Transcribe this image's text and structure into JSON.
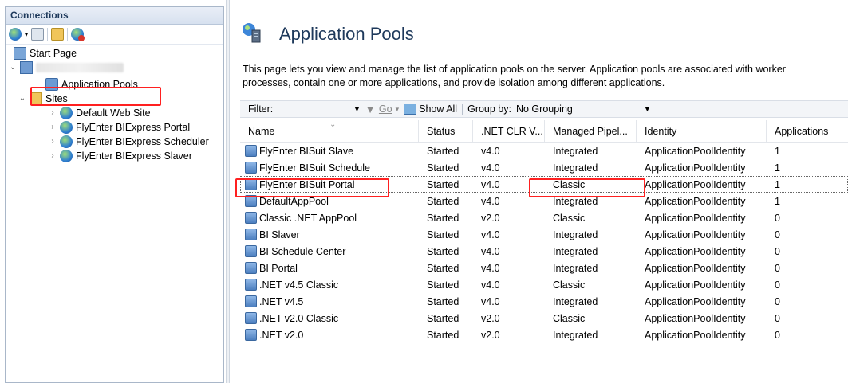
{
  "connections": {
    "title": "Connections",
    "tree": {
      "start_page": "Start Page",
      "application_pools": "Application Pools",
      "sites": "Sites",
      "site_items": [
        "Default Web Site",
        "FlyEnter BIExpress Portal",
        "FlyEnter BIExpress Scheduler",
        "FlyEnter BIExpress Slaver"
      ]
    }
  },
  "main": {
    "title": "Application Pools",
    "description": "This page lets you view and manage the list of application pools on the server. Application pools are associated with worker processes, contain one or more applications, and provide isolation among different applications.",
    "filter": {
      "label": "Filter:",
      "go": "Go",
      "show_all": "Show All",
      "group_by_label": "Group by:",
      "group_by_value": "No Grouping"
    },
    "columns": {
      "name": "Name",
      "status": "Status",
      "clr": ".NET CLR V...",
      "pipeline": "Managed Pipel...",
      "identity": "Identity",
      "applications": "Applications"
    },
    "rows": [
      {
        "name": "FlyEnter BISuit Slave",
        "status": "Started",
        "clr": "v4.0",
        "pipeline": "Integrated",
        "identity": "ApplicationPoolIdentity",
        "apps": "1"
      },
      {
        "name": "FlyEnter BISuit Schedule",
        "status": "Started",
        "clr": "v4.0",
        "pipeline": "Integrated",
        "identity": "ApplicationPoolIdentity",
        "apps": "1"
      },
      {
        "name": "FlyEnter BISuit Portal",
        "status": "Started",
        "clr": "v4.0",
        "pipeline": "Classic",
        "identity": "ApplicationPoolIdentity",
        "apps": "1"
      },
      {
        "name": "DefaultAppPool",
        "status": "Started",
        "clr": "v4.0",
        "pipeline": "Integrated",
        "identity": "ApplicationPoolIdentity",
        "apps": "1"
      },
      {
        "name": "Classic .NET AppPool",
        "status": "Started",
        "clr": "v2.0",
        "pipeline": "Classic",
        "identity": "ApplicationPoolIdentity",
        "apps": "0"
      },
      {
        "name": "BI Slaver",
        "status": "Started",
        "clr": "v4.0",
        "pipeline": "Integrated",
        "identity": "ApplicationPoolIdentity",
        "apps": "0"
      },
      {
        "name": "BI Schedule Center",
        "status": "Started",
        "clr": "v4.0",
        "pipeline": "Integrated",
        "identity": "ApplicationPoolIdentity",
        "apps": "0"
      },
      {
        "name": "BI Portal",
        "status": "Started",
        "clr": "v4.0",
        "pipeline": "Integrated",
        "identity": "ApplicationPoolIdentity",
        "apps": "0"
      },
      {
        "name": ".NET v4.5 Classic",
        "status": "Started",
        "clr": "v4.0",
        "pipeline": "Classic",
        "identity": "ApplicationPoolIdentity",
        "apps": "0"
      },
      {
        "name": ".NET v4.5",
        "status": "Started",
        "clr": "v4.0",
        "pipeline": "Integrated",
        "identity": "ApplicationPoolIdentity",
        "apps": "0"
      },
      {
        "name": ".NET v2.0 Classic",
        "status": "Started",
        "clr": "v2.0",
        "pipeline": "Classic",
        "identity": "ApplicationPoolIdentity",
        "apps": "0"
      },
      {
        "name": ".NET v2.0",
        "status": "Started",
        "clr": "v2.0",
        "pipeline": "Integrated",
        "identity": "ApplicationPoolIdentity",
        "apps": "0"
      }
    ]
  }
}
